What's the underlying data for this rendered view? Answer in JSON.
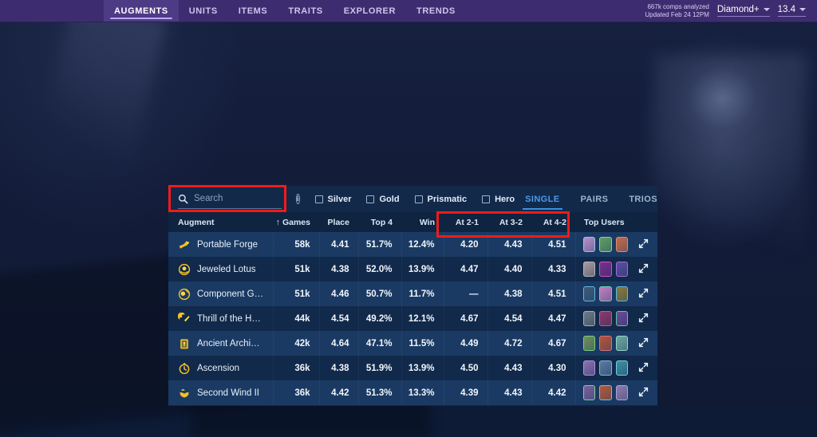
{
  "topnav": {
    "items": [
      {
        "label": "AUGMENTS",
        "active": true
      },
      {
        "label": "UNITS",
        "active": false
      },
      {
        "label": "ITEMS",
        "active": false
      },
      {
        "label": "TRAITS",
        "active": false
      },
      {
        "label": "EXPLORER",
        "active": false
      },
      {
        "label": "TRENDS",
        "active": false
      }
    ],
    "stats_line1": "667k comps analyzed",
    "stats_line2": "Updated Feb 24 12PM",
    "rank_select": "Diamond+",
    "patch_select": "13.4"
  },
  "toolbar": {
    "search_placeholder": "Search",
    "search_value": "",
    "search_icon": "search-icon",
    "info_icon": "info-icon",
    "info_glyph": "i",
    "filters": [
      {
        "label": "Silver",
        "checked": false
      },
      {
        "label": "Gold",
        "checked": false
      },
      {
        "label": "Prismatic",
        "checked": false
      },
      {
        "label": "Hero",
        "checked": false
      }
    ],
    "mode_tabs": [
      {
        "label": "SINGLE",
        "active": true
      },
      {
        "label": "PAIRS",
        "active": false
      },
      {
        "label": "TRIOS",
        "active": false
      }
    ]
  },
  "table": {
    "columns": [
      {
        "key": "augment",
        "label": "Augment"
      },
      {
        "key": "games",
        "label": "↑ Games"
      },
      {
        "key": "place",
        "label": "Place"
      },
      {
        "key": "top4",
        "label": "Top 4"
      },
      {
        "key": "win",
        "label": "Win"
      },
      {
        "key": "at21",
        "label": "At 2-1"
      },
      {
        "key": "at32",
        "label": "At 3-2"
      },
      {
        "key": "at42",
        "label": "At 4-2"
      },
      {
        "key": "users",
        "label": "Top Users"
      }
    ],
    "rows": [
      {
        "augment": "Portable Forge",
        "games": "58k",
        "place": "4.41",
        "top4": "51.7%",
        "win": "12.4%",
        "at21": "4.20",
        "at32": "4.43",
        "at42": "4.51",
        "users": [
          "#b98ec9",
          "#5f9e63",
          "#c56b4a"
        ],
        "borders": [
          "#9fc2e6",
          "#8fd0a0",
          "#d88f6a"
        ]
      },
      {
        "augment": "Jeweled Lotus",
        "games": "51k",
        "place": "4.38",
        "top4": "52.0%",
        "win": "13.9%",
        "at21": "4.47",
        "at32": "4.40",
        "at42": "4.33",
        "users": [
          "#a99a9d",
          "#7a2f8e",
          "#5a4fa0"
        ],
        "borders": [
          "#b5b5bd",
          "#d24fd2",
          "#a06ce0"
        ]
      },
      {
        "augment": "Component Gra...",
        "games": "51k",
        "place": "4.46",
        "top4": "50.7%",
        "win": "11.7%",
        "at21": "—",
        "at32": "4.38",
        "at42": "4.51",
        "users": [
          "#3d5a77",
          "#c47fc0",
          "#8a7a3a"
        ],
        "borders": [
          "#5fb8e0",
          "#6fd0a8",
          "#5fb8e0"
        ]
      },
      {
        "augment": "Thrill of the Hun...",
        "games": "44k",
        "place": "4.54",
        "top4": "49.2%",
        "win": "12.1%",
        "at21": "4.67",
        "at32": "4.54",
        "at42": "4.47",
        "users": [
          "#6e7a86",
          "#8d3a6a",
          "#6d4aa0"
        ],
        "borders": [
          "#9fb0c0",
          "#d050a0",
          "#60c890"
        ]
      },
      {
        "augment": "Ancient Archives I",
        "games": "42k",
        "place": "4.64",
        "top4": "47.1%",
        "win": "11.5%",
        "at21": "4.49",
        "at32": "4.72",
        "at42": "4.67",
        "users": [
          "#6f8f5e",
          "#b4543a",
          "#6fa5a0"
        ],
        "borders": [
          "#78d07a",
          "#d8707a",
          "#8fd8c8"
        ]
      },
      {
        "augment": "Ascension",
        "games": "36k",
        "place": "4.38",
        "top4": "51.9%",
        "win": "13.9%",
        "at21": "4.50",
        "at32": "4.43",
        "at42": "4.30",
        "users": [
          "#8a6fb0",
          "#5a7aa0",
          "#3f8fa8"
        ],
        "borders": [
          "#b08fe0",
          "#7fb0e0",
          "#6fd0d8"
        ]
      },
      {
        "augment": "Second Wind II",
        "games": "36k",
        "place": "4.42",
        "top4": "51.3%",
        "win": "13.3%",
        "at21": "4.39",
        "at32": "4.43",
        "at42": "4.42",
        "users": [
          "#7a5f9a",
          "#b05a3a",
          "#8f7aae"
        ],
        "borders": [
          "#7fd0a0",
          "#7fb8e0",
          "#b0a0d8"
        ]
      }
    ]
  },
  "annotations": {
    "search_highlight_color": "#f01c18",
    "stage_columns_highlight_color": "#f01c18"
  }
}
